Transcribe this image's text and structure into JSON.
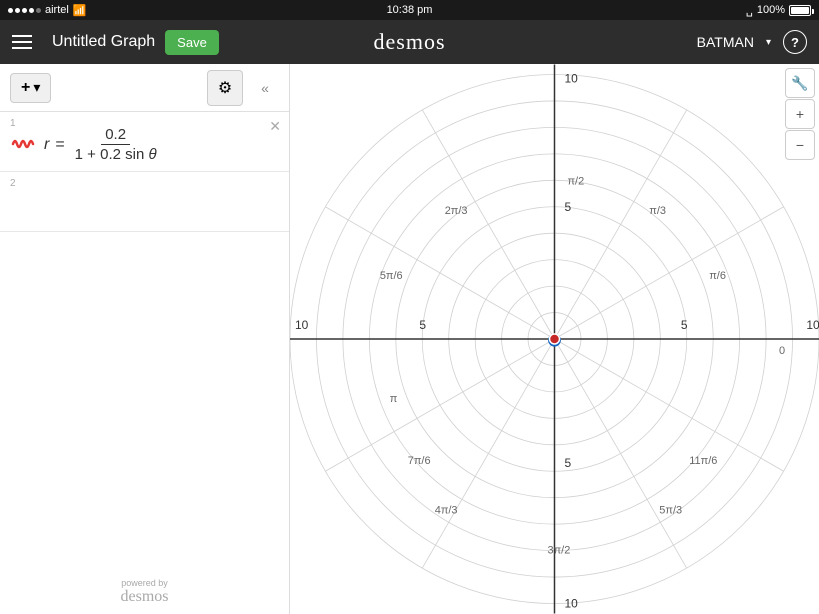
{
  "statusBar": {
    "carrier": "airtel",
    "time": "10:38 pm",
    "bluetooth": "✱",
    "battery": "100%"
  },
  "topNav": {
    "menuLabel": "menu",
    "title": "Untitled Graph",
    "saveLabel": "Save",
    "logoText": "desmos",
    "username": "BATMAN",
    "helpLabel": "?"
  },
  "leftPanel": {
    "addLabel": "+",
    "addChevron": "▾",
    "settingsIcon": "⚙",
    "collapseIcon": "«",
    "expressions": [
      {
        "number": "1",
        "formula": "r = 0.2 / (1 + 0.2 sin θ)",
        "hasWave": true
      },
      {
        "number": "2",
        "formula": "",
        "hasWave": false
      }
    ],
    "poweredBy": "powered by",
    "brandName": "desmos"
  },
  "graph": {
    "xMin": -10,
    "xMax": 10,
    "yMin": -10,
    "yMax": 10,
    "labels": {
      "top": "10",
      "bottom": "10",
      "left": "10",
      "right": "10",
      "y5": "5",
      "yn5": "5",
      "x5": "5",
      "xn5": "5",
      "angles": [
        "π/2",
        "2π/3",
        "π/3",
        "π/6",
        "0",
        "11π/6",
        "5π/3",
        "3π/2",
        "4π/3",
        "7π/6",
        "π",
        "5π/6"
      ]
    },
    "tools": [
      "🔧",
      "+",
      "−"
    ]
  }
}
